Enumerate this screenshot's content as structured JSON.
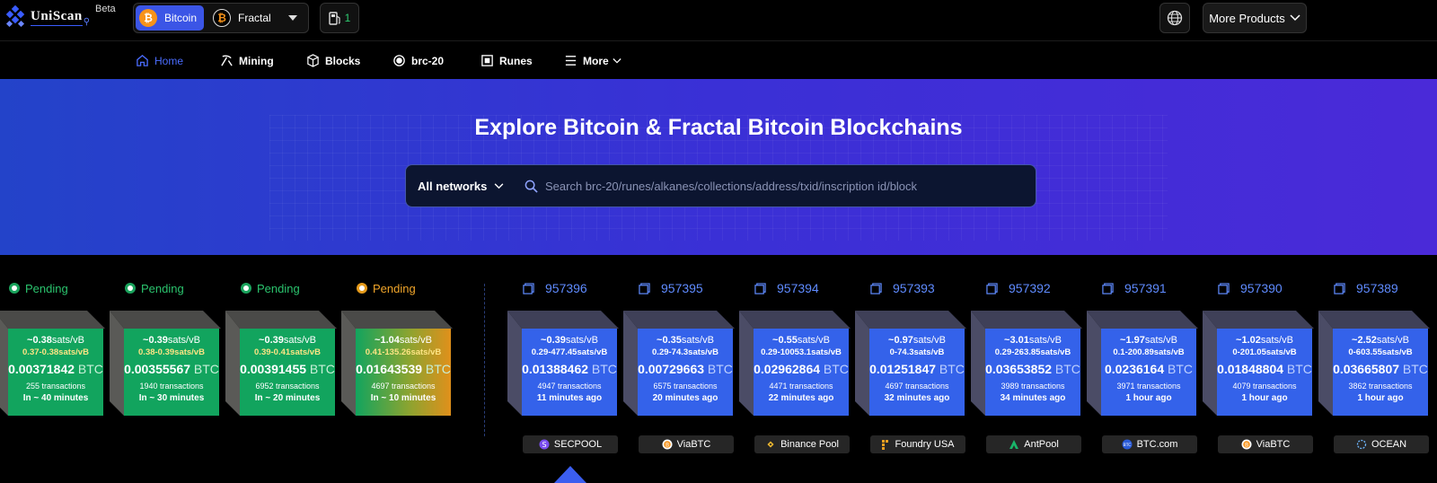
{
  "header": {
    "logo_text": "UniScan",
    "beta_label": "Beta",
    "networks": [
      {
        "label": "Bitcoin",
        "active": true
      },
      {
        "label": "Fractal",
        "active": false
      }
    ],
    "gas_value": "1",
    "more_products_label": "More Products"
  },
  "nav": {
    "items": [
      {
        "label": "Home",
        "icon": "home-icon"
      },
      {
        "label": "Mining",
        "icon": "pickaxe-icon"
      },
      {
        "label": "Blocks",
        "icon": "cube-icon"
      },
      {
        "label": "brc-20",
        "icon": "circle-icon"
      },
      {
        "label": "Runes",
        "icon": "square-icon"
      },
      {
        "label": "More",
        "icon": "menu-icon"
      }
    ]
  },
  "hero": {
    "title": "Explore Bitcoin & Fractal Bitcoin Blockchains",
    "network_select": "All networks",
    "search_placeholder": "Search brc-20/runes/alkanes/collections/address/txid/inscription id/block"
  },
  "colors": {
    "accent": "#3b55e6",
    "pending_green": "#12a45e",
    "pending_orange": "#e0901b",
    "block_blue": "#3462ea"
  },
  "pending_blocks": [
    {
      "label": "Pending",
      "status": "green",
      "fee": "~0.38",
      "fee_unit": "sats/vB",
      "range": "0.37-0.38sats/vB",
      "total": "0.00371842",
      "unit": "BTC",
      "txs": "255 transactions",
      "eta": "In ~ 40 minutes"
    },
    {
      "label": "Pending",
      "status": "green",
      "fee": "~0.39",
      "fee_unit": "sats/vB",
      "range": "0.38-0.39sats/vB",
      "total": "0.00355567",
      "unit": "BTC",
      "txs": "1940 transactions",
      "eta": "In ~ 30 minutes"
    },
    {
      "label": "Pending",
      "status": "green",
      "fee": "~0.39",
      "fee_unit": "sats/vB",
      "range": "0.39-0.41sats/vB",
      "total": "0.00391455",
      "unit": "BTC",
      "txs": "6952 transactions",
      "eta": "In ~ 20 minutes"
    },
    {
      "label": "Pending",
      "status": "orange",
      "fee": "~1.04",
      "fee_unit": "sats/vB",
      "range": "0.41-135.26sats/vB",
      "total": "0.01643539",
      "unit": "BTC",
      "txs": "4697 transactions",
      "eta": "In ~ 10 minutes"
    }
  ],
  "mined_blocks": [
    {
      "height": "957396",
      "fee": "~0.39",
      "fee_unit": "sats/vB",
      "range": "0.29-477.45sats/vB",
      "total": "0.01388462",
      "unit": "BTC",
      "txs": "4947 transactions",
      "age": "11 minutes ago",
      "pool": "SECPOOL",
      "pool_icon": "secpool-icon"
    },
    {
      "height": "957395",
      "fee": "~0.35",
      "fee_unit": "sats/vB",
      "range": "0.29-74.3sats/vB",
      "total": "0.00729663",
      "unit": "BTC",
      "txs": "6575 transactions",
      "age": "20 minutes ago",
      "pool": "ViaBTC",
      "pool_icon": "viabtc-icon"
    },
    {
      "height": "957394",
      "fee": "~0.55",
      "fee_unit": "sats/vB",
      "range": "0.29-10053.1sats/vB",
      "total": "0.02962864",
      "unit": "BTC",
      "txs": "4471 transactions",
      "age": "22 minutes ago",
      "pool": "Binance Pool",
      "pool_icon": "binance-icon"
    },
    {
      "height": "957393",
      "fee": "~0.97",
      "fee_unit": "sats/vB",
      "range": "0-74.3sats/vB",
      "total": "0.01251847",
      "unit": "BTC",
      "txs": "4697 transactions",
      "age": "32 minutes ago",
      "pool": "Foundry USA",
      "pool_icon": "foundry-icon"
    },
    {
      "height": "957392",
      "fee": "~3.01",
      "fee_unit": "sats/vB",
      "range": "0.29-263.85sats/vB",
      "total": "0.03653852",
      "unit": "BTC",
      "txs": "3989 transactions",
      "age": "34 minutes ago",
      "pool": "AntPool",
      "pool_icon": "antpool-icon"
    },
    {
      "height": "957391",
      "fee": "~1.97",
      "fee_unit": "sats/vB",
      "range": "0.1-200.89sats/vB",
      "total": "0.0236164",
      "unit": "BTC",
      "txs": "3971 transactions",
      "age": "1 hour ago",
      "pool": "BTC.com",
      "pool_icon": "btccom-icon"
    },
    {
      "height": "957390",
      "fee": "~1.02",
      "fee_unit": "sats/vB",
      "range": "0-201.05sats/vB",
      "total": "0.01848804",
      "unit": "BTC",
      "txs": "4079 transactions",
      "age": "1 hour ago",
      "pool": "ViaBTC",
      "pool_icon": "viabtc-icon"
    },
    {
      "height": "957389",
      "fee": "~2.52",
      "fee_unit": "sats/vB",
      "range": "0-603.55sats/vB",
      "total": "0.03665807",
      "unit": "BTC",
      "txs": "3862 transactions",
      "age": "1 hour ago",
      "pool": "OCEAN",
      "pool_icon": "ocean-icon"
    }
  ]
}
